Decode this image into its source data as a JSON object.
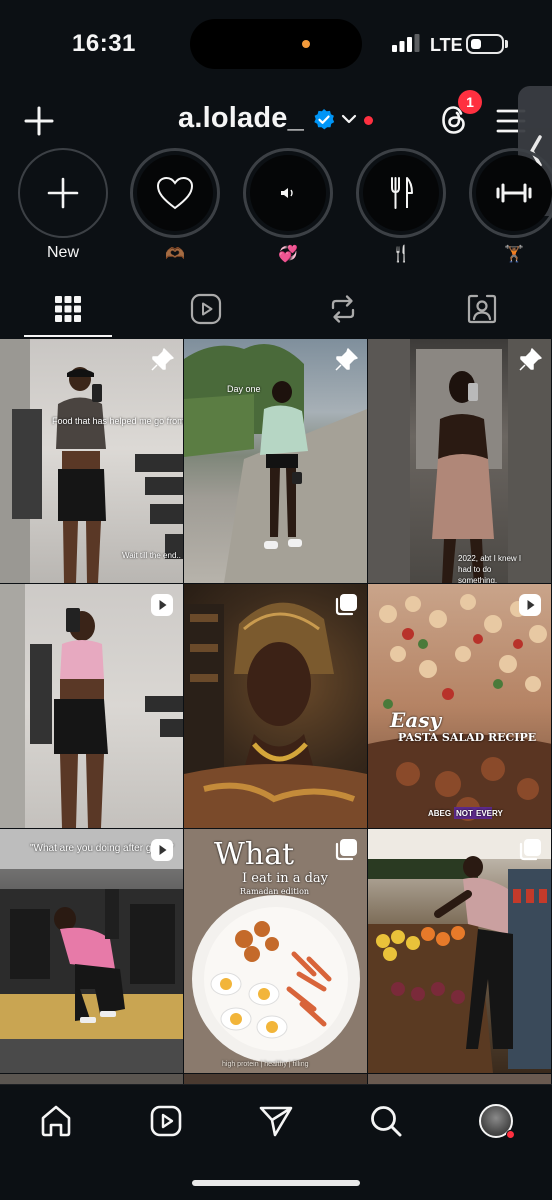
{
  "status_bar": {
    "time": "16:31",
    "network": "LTE",
    "battery_level": 0.35
  },
  "header": {
    "username": "a.lolade_",
    "threads_badge": "1",
    "icons": {
      "add": "plus-icon",
      "verified": "verified-badge-icon",
      "switch": "chevron-down-icon",
      "threads": "threads-icon",
      "menu": "hamburger-menu-icon"
    }
  },
  "highlights": [
    {
      "label": "New",
      "icon": "plus-icon"
    },
    {
      "label": "🫶🏾",
      "icon": "heart-outline-icon"
    },
    {
      "label": "💞",
      "icon": "speaker-icon"
    },
    {
      "label": "🍴",
      "icon": "fork-knife-icon"
    },
    {
      "label": "🏋🏾",
      "icon": "dumbbell-icon"
    }
  ],
  "tabs": [
    {
      "name": "posts",
      "icon": "grid-icon",
      "active": true
    },
    {
      "name": "reels",
      "icon": "reels-icon",
      "active": false
    },
    {
      "name": "reposts",
      "icon": "repost-icon",
      "active": false
    },
    {
      "name": "tagged",
      "icon": "tagged-icon",
      "active": false
    }
  ],
  "posts": [
    {
      "type": "pinned",
      "caption_main": "Food that has helped me go from this...",
      "caption_sub": "Wait till the end.."
    },
    {
      "type": "pinned",
      "caption_main": "Day one"
    },
    {
      "type": "pinned",
      "caption_main": "2022, abt I knew I had to do something."
    },
    {
      "type": "reel"
    },
    {
      "type": "carousel"
    },
    {
      "type": "reel",
      "overlay_title": "Easy",
      "overlay_subtitle": "PASTA SALAD RECIPE",
      "overlay_brand_a": "ABEG",
      "overlay_brand_b": "NOT",
      "overlay_brand_c": "EVERY"
    },
    {
      "type": "reel",
      "caption_main": "\"What are you doing after gym?\""
    },
    {
      "type": "carousel",
      "overlay_title": "What",
      "overlay_subtitle": "I eat in a day",
      "overlay_tag": "Ramadan edition",
      "overlay_footer": "high protein | healthy | filling"
    },
    {
      "type": "carousel"
    }
  ],
  "bottom_nav": [
    {
      "name": "home",
      "icon": "home-icon"
    },
    {
      "name": "reels",
      "icon": "reels-icon"
    },
    {
      "name": "messages",
      "icon": "send-icon"
    },
    {
      "name": "search",
      "icon": "search-icon"
    },
    {
      "name": "profile",
      "icon": "avatar"
    }
  ],
  "colors": {
    "background": "#0c1014",
    "verified": "#0095f6",
    "notification": "#ff3040",
    "text": "#f5f5f5"
  }
}
